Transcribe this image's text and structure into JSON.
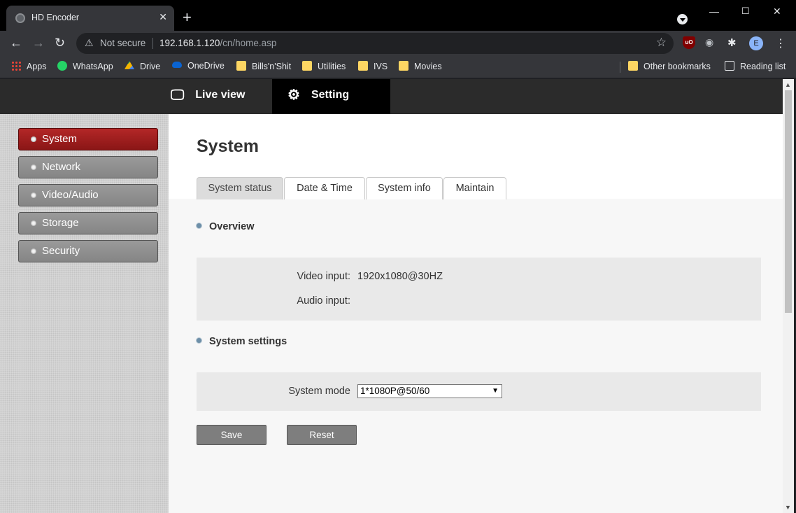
{
  "browser": {
    "tab_title": "HD Encoder",
    "security_label": "Not secure",
    "url_host": "192.168.1.120",
    "url_path": "/cn/home.asp",
    "profile_initial": "E",
    "bookmarks": [
      "Apps",
      "WhatsApp",
      "Drive",
      "OneDrive",
      "Bills'n'Shit",
      "Utilities",
      "IVS",
      "Movies"
    ],
    "other_bookmarks": "Other bookmarks",
    "reading_list": "Reading list"
  },
  "topnav": {
    "live_view": "Live view",
    "setting": "Setting"
  },
  "sidebar": {
    "items": [
      {
        "label": "System",
        "active": true
      },
      {
        "label": "Network",
        "active": false
      },
      {
        "label": "Video/Audio",
        "active": false
      },
      {
        "label": "Storage",
        "active": false
      },
      {
        "label": "Security",
        "active": false
      }
    ]
  },
  "main": {
    "title": "System",
    "tabs": [
      {
        "label": "System status",
        "active": true
      },
      {
        "label": "Date & Time",
        "active": false
      },
      {
        "label": "System info",
        "active": false
      },
      {
        "label": "Maintain",
        "active": false
      }
    ],
    "overview": {
      "heading": "Overview",
      "video_input_label": "Video input:",
      "video_input_value": "1920x1080@30HZ",
      "audio_input_label": "Audio input:",
      "audio_input_value": ""
    },
    "system_settings": {
      "heading": "System settings",
      "mode_label": "System mode",
      "mode_value": "1*1080P@50/60"
    },
    "buttons": {
      "save": "Save",
      "reset": "Reset"
    }
  },
  "colors": {
    "active_sidebar": "#a11f1f",
    "nav_bar": "#2b2b2b"
  }
}
